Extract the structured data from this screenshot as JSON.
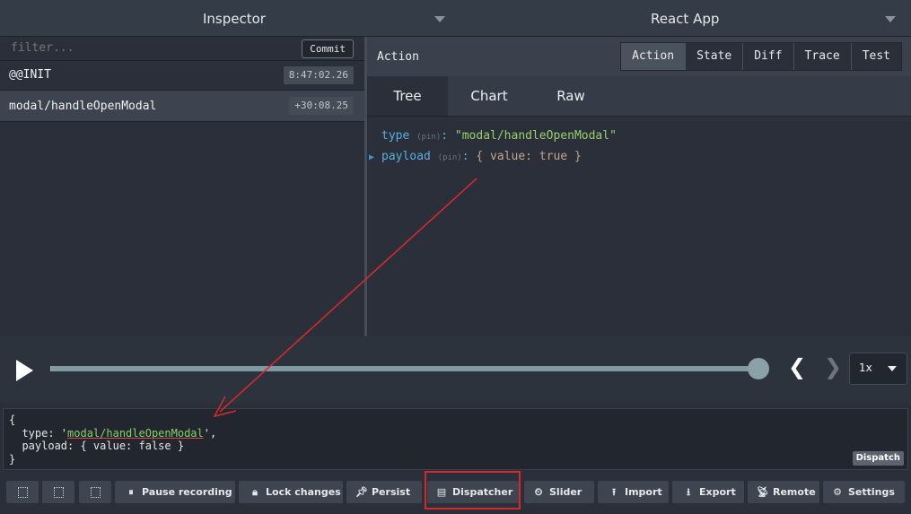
{
  "topbar": {
    "left_title": "Inspector",
    "right_title": "React App"
  },
  "actions_list": {
    "filter_placeholder": "filter...",
    "commit_label": "Commit",
    "items": [
      {
        "name": "@@INIT",
        "time": "8:47:02.26"
      },
      {
        "name": "modal/handleOpenModal",
        "time": "+30:08.25"
      }
    ]
  },
  "monitor": {
    "header_title": "Action",
    "tabs": [
      "Action",
      "State",
      "Diff",
      "Trace",
      "Test"
    ],
    "active_tab": "Action",
    "subtabs": [
      "Tree",
      "Chart",
      "Raw"
    ],
    "active_subtab": "Tree",
    "tree": {
      "type_key": "type",
      "pin": "(pin)",
      "type_value": "\"modal/handleOpenModal\"",
      "payload_key": "payload",
      "payload_value": "{ value: true }"
    }
  },
  "slider": {
    "speed": "1x",
    "progress": 1.0
  },
  "dispatcher": {
    "line1": "{",
    "line2_pre": "  type: '",
    "line2_str": "modal/handleOpenModal",
    "line2_post": "',",
    "line3": "  payload: { value: false }",
    "line4": "}",
    "dispatch_label": "Dispatch"
  },
  "toolbar": {
    "buttons": [
      {
        "label": "Pause recording",
        "icon": "pause-icon"
      },
      {
        "label": "Lock changes",
        "icon": "lock-icon"
      },
      {
        "label": "Persist",
        "icon": "pin-icon"
      },
      {
        "label": "Dispatcher",
        "icon": "keyboard-icon"
      },
      {
        "label": "Slider",
        "icon": "clock-icon"
      },
      {
        "label": "Import",
        "icon": "upload-icon"
      },
      {
        "label": "Export",
        "icon": "download-icon"
      },
      {
        "label": "Remote",
        "icon": "antenna-icon"
      },
      {
        "label": "Settings",
        "icon": "gear-icon"
      }
    ]
  },
  "colors": {
    "highlight": "#d42a2a",
    "arrow": "#d42a2a"
  }
}
